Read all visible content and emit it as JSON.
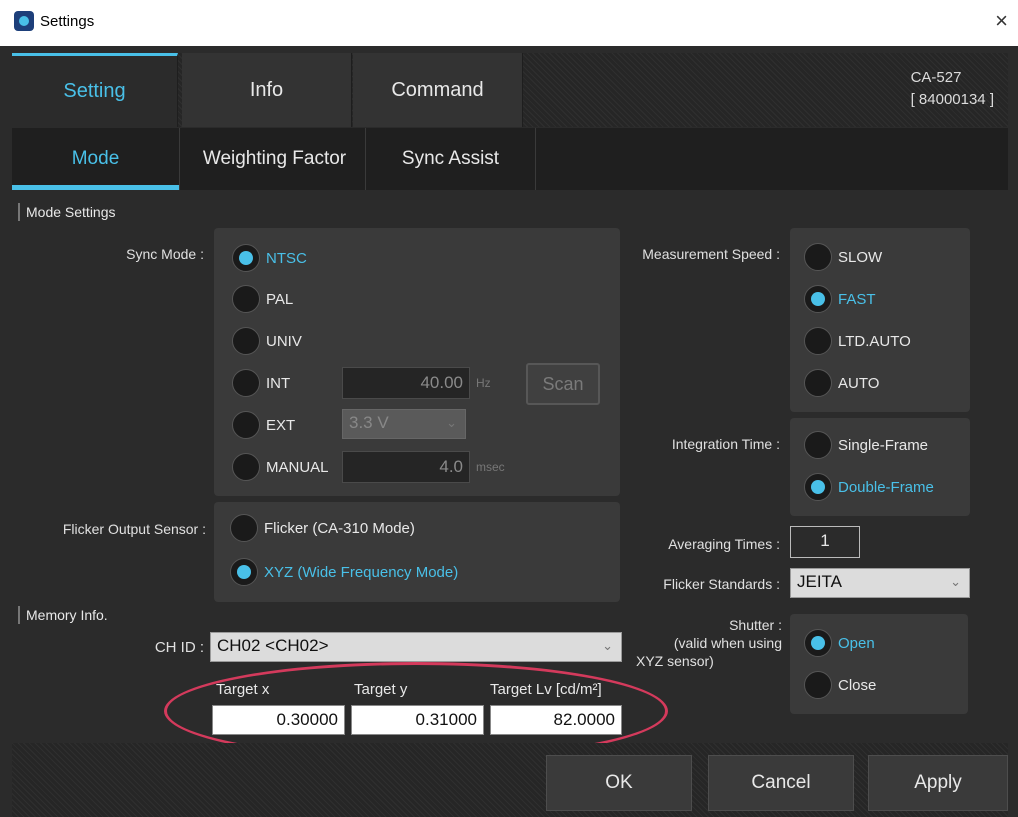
{
  "window": {
    "title": "Settings",
    "close_glyph": "×"
  },
  "tabs": [
    {
      "label": "Setting",
      "active": true
    },
    {
      "label": "Info",
      "active": false
    },
    {
      "label": "Command",
      "active": false
    }
  ],
  "device": {
    "model": "CA-527",
    "serial": "[ 84000134 ]"
  },
  "subtabs": [
    {
      "label": "Mode",
      "active": true
    },
    {
      "label": "Weighting Factor",
      "active": false
    },
    {
      "label": "Sync Assist",
      "active": false
    }
  ],
  "mode_settings": {
    "header": "Mode Settings",
    "sync_mode": {
      "label": "Sync Mode :",
      "options": [
        "NTSC",
        "PAL",
        "UNIV",
        "INT",
        "EXT",
        "MANUAL"
      ],
      "selected": "NTSC",
      "int_value": "40.00",
      "int_unit": "Hz",
      "scan_label": "Scan",
      "ext_value": "3.3 V",
      "manual_value": "4.0",
      "manual_unit": "msec"
    },
    "measurement_speed": {
      "label": "Measurement Speed :",
      "options": [
        "SLOW",
        "FAST",
        "LTD.AUTO",
        "AUTO"
      ],
      "selected": "FAST"
    },
    "integration_time": {
      "label": "Integration Time :",
      "options": [
        "Single-Frame",
        "Double-Frame"
      ],
      "selected": "Double-Frame"
    },
    "flicker_output_sensor": {
      "label": "Flicker Output Sensor :",
      "options": [
        "Flicker (CA-310 Mode)",
        "XYZ (Wide Frequency Mode)"
      ],
      "selected": "XYZ (Wide Frequency Mode)"
    },
    "averaging_times": {
      "label": "Averaging Times :",
      "value": "1"
    },
    "flicker_standards": {
      "label": "Flicker Standards :",
      "value": "JEITA"
    },
    "shutter": {
      "label_lines": [
        "Shutter :",
        "(valid when using",
        "XYZ sensor)"
      ],
      "options": [
        "Open",
        "Close"
      ],
      "selected": "Open"
    }
  },
  "memory_info": {
    "header": "Memory Info.",
    "ch_id_label": "CH ID :",
    "ch_id_value": "CH02 <CH02>",
    "targets": [
      {
        "label": "Target x",
        "value": "0.30000"
      },
      {
        "label": "Target y",
        "value": "0.31000"
      },
      {
        "label": "Target Lv [cd/m²]",
        "value": "82.0000"
      }
    ]
  },
  "buttons": {
    "ok": "OK",
    "cancel": "Cancel",
    "apply": "Apply"
  },
  "colors": {
    "accent": "#49c0e8",
    "highlight": "#d43a5c",
    "background": "#2b2b2b"
  }
}
